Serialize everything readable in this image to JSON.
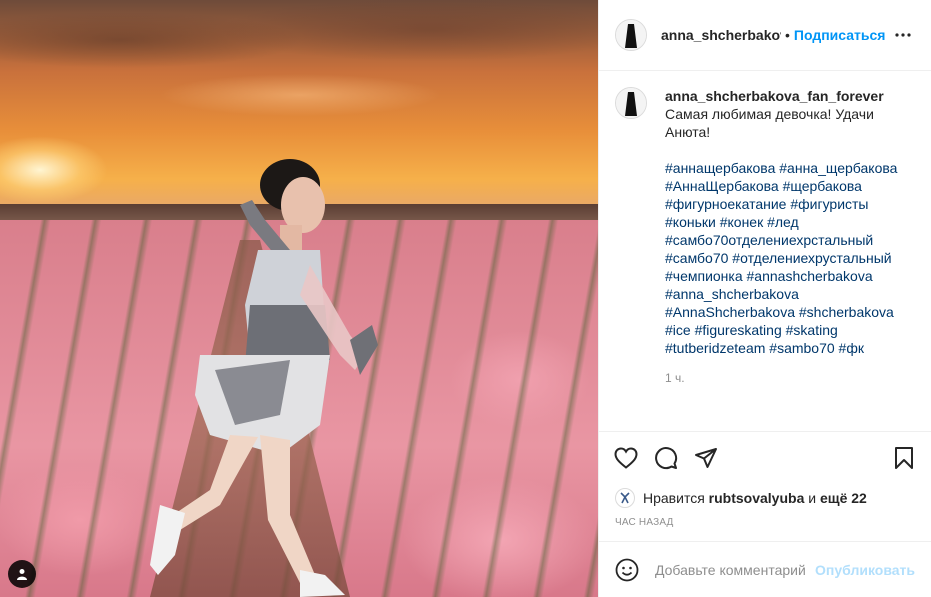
{
  "header": {
    "username": "anna_shcherbakova_fan_forever",
    "separator": "•",
    "follow_label": "Подписаться",
    "more_icon": "more-horizontal-icon"
  },
  "caption": {
    "username": "anna_shcherbakova_fan_forever",
    "text": "Самая любимая девочка! Удачи Анюта!",
    "hashtags": [
      "#аннащербакова #анна_щербакова",
      "#АннаЩербакова #щербакова",
      "#фигурноекатание #фигуристы",
      "#коньки #конек #лед",
      "#самбо70отделениехрстальный",
      "#самбо70 #отделениехрустальный",
      "#чемпионка #annashcherbakova",
      "#anna_shcherbakova",
      "#AnnaShcherbakova #shcherbakova",
      "#ice #figureskating #skating",
      "#tutberidzeteam #sambo70 #фк"
    ],
    "time": "1 ч."
  },
  "actions": {
    "like_icon": "heart-icon",
    "comment_icon": "comment-icon",
    "share_icon": "share-icon",
    "save_icon": "bookmark-icon"
  },
  "likes": {
    "prefix": "Нравится",
    "user": "rubtsovalyuba",
    "and": "и",
    "others": "ещё 22"
  },
  "posted": "ЧАС НАЗАД",
  "add_comment": {
    "placeholder": "Добавьте комментарий...",
    "publish_label": "Опубликовать"
  },
  "colors": {
    "link": "#00376b",
    "follow": "#0095f6",
    "publish_disabled": "#b2dffc",
    "secondary_text": "#8e8e8e"
  }
}
